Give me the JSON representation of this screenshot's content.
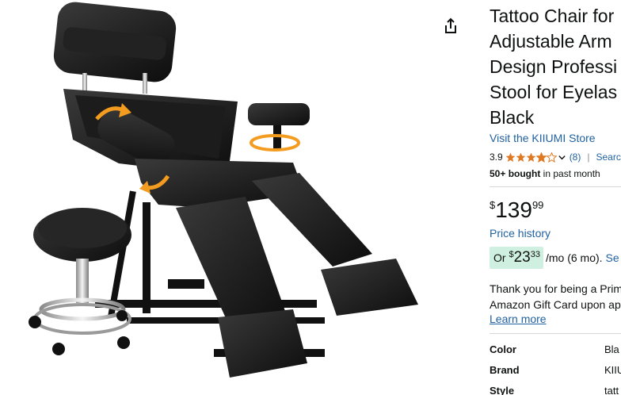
{
  "product": {
    "title": "Tattoo Chair for\nAdjustable Arm\nDesign Professi\nStool for Eyelas\nBlack",
    "store": "Visit the KIIUMI Store",
    "rating": "3.9",
    "rating_stars": 3.9,
    "rating_count": "(8)",
    "search_link": "Search",
    "bought_bold": "50+ bought",
    "bought_rest": " in past month"
  },
  "price": {
    "symbol": "$",
    "whole": "139",
    "fraction": "99",
    "history_link": "Price history"
  },
  "monthly": {
    "prefix": "Or ",
    "symbol": "$",
    "whole": "23",
    "fraction": "33",
    "term": "/mo (6 mo).",
    "link": "Se"
  },
  "promo": {
    "line1": "Thank you for being a Prim",
    "line2": "Amazon Gift Card upon ap",
    "learn_more": "Learn more"
  },
  "specs": [
    {
      "label": "Color",
      "value": "Bla"
    },
    {
      "label": "Brand",
      "value": "KIIU"
    },
    {
      "label": "Style",
      "value": "tatt"
    }
  ],
  "colors": {
    "link": "#2162a1",
    "star": "#de7921",
    "emi_badge": "#cff0e0",
    "text": "#0f1111"
  },
  "icons": {
    "share": "share-icon",
    "star": "star-icon",
    "chevron": "chevron-down-icon"
  }
}
